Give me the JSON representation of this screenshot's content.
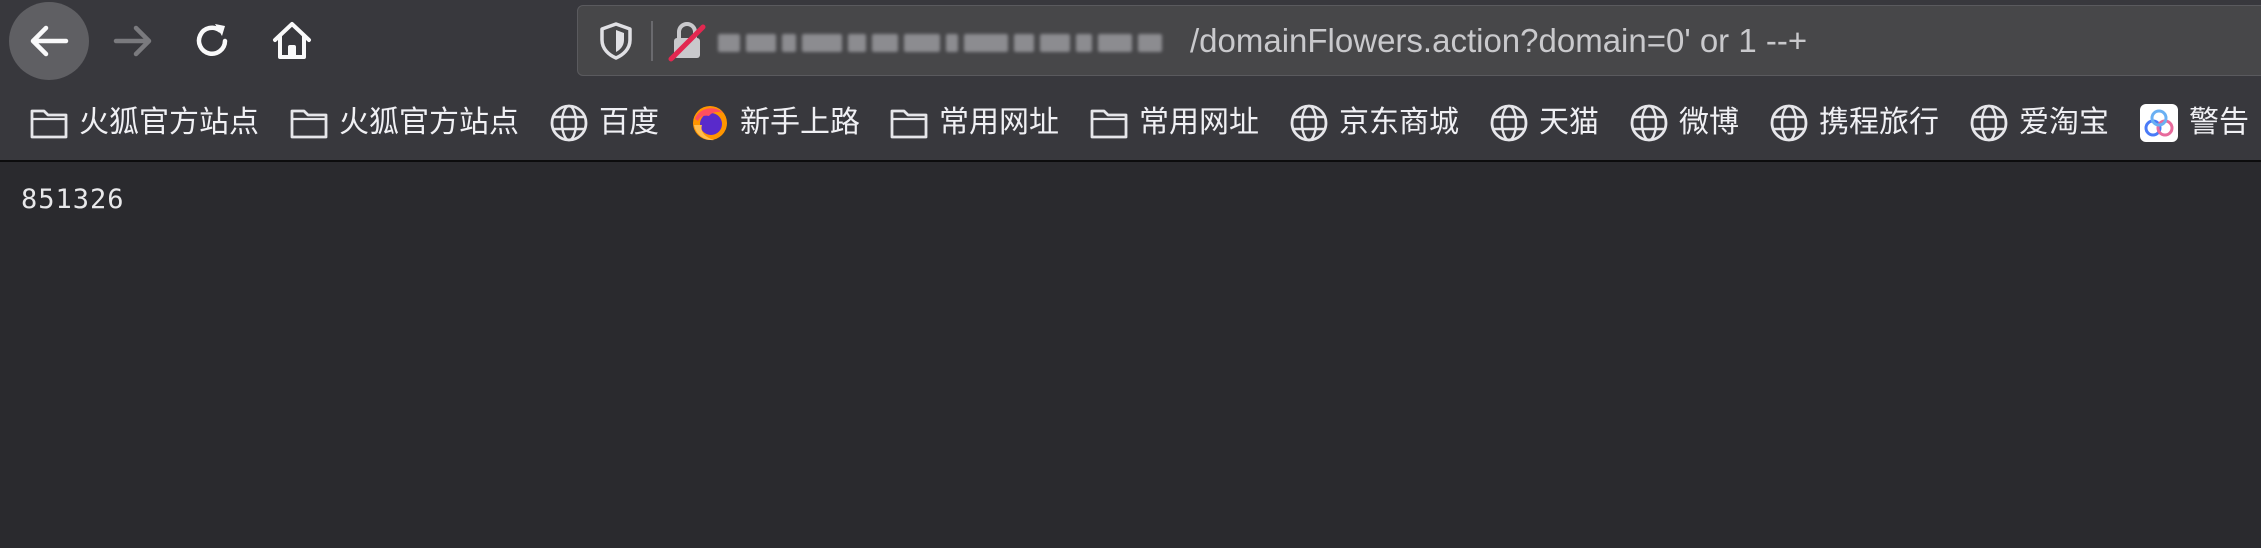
{
  "toolbar": {
    "back_icon": "arrow-left-icon",
    "forward_icon": "arrow-right-icon",
    "reload_icon": "reload-icon",
    "home_icon": "home-icon"
  },
  "urlbar": {
    "url_visible": "/domainFlowers.action?domain=0' or 1 --+",
    "tracking_icon": "shield-icon",
    "security_icon": "insecure-lock-icon"
  },
  "bookmarks": [
    {
      "label": "火狐官方站点",
      "icon": "folder-icon"
    },
    {
      "label": "火狐官方站点",
      "icon": "folder-icon"
    },
    {
      "label": "百度",
      "icon": "globe-icon"
    },
    {
      "label": "新手上路",
      "icon": "firefox-icon"
    },
    {
      "label": "常用网址",
      "icon": "folder-icon"
    },
    {
      "label": "常用网址",
      "icon": "folder-icon"
    },
    {
      "label": "京东商城",
      "icon": "globe-icon"
    },
    {
      "label": "天猫",
      "icon": "globe-icon"
    },
    {
      "label": "微博",
      "icon": "globe-icon"
    },
    {
      "label": "携程旅行",
      "icon": "globe-icon"
    },
    {
      "label": "爱淘宝",
      "icon": "globe-icon"
    },
    {
      "label": "警告",
      "icon": "app-icon"
    }
  ],
  "page": {
    "result_text": "851326"
  },
  "colors": {
    "chrome_bg": "#38383d",
    "content_bg": "#2a2a2e",
    "urlbar_bg": "#474749",
    "text": "#f0f0f4",
    "insecure_red": "#e22850"
  }
}
